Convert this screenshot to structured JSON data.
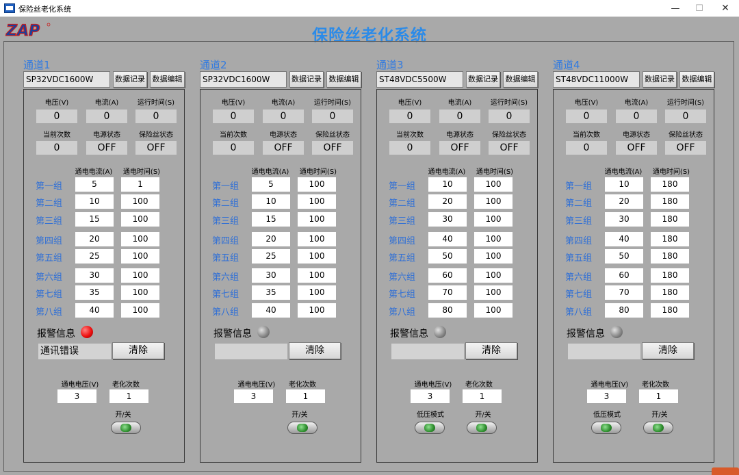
{
  "window": {
    "title": "保险丝老化系统",
    "minimize": "—",
    "maximize": "☐",
    "close": "✕"
  },
  "logo_text": "ZAP",
  "app_title": "保险丝老化系统",
  "labels": {
    "voltage": "电压(V)",
    "current": "电流(A)",
    "runtime": "运行时间(S)",
    "current_count": "当前次数",
    "power_state": "电源状态",
    "fuse_state": "保险丝状态",
    "col_current": "通电电流(A)",
    "col_time": "通电时间(S)",
    "alarm": "报警信息",
    "clear": "清除",
    "power_voltage": "通电电压(V)",
    "aging_count": "老化次数",
    "on_off": "开/关",
    "low_voltage_mode": "低压模式",
    "data_record": "数据记录",
    "data_edit": "数据编辑"
  },
  "groups": [
    "第一组",
    "第二组",
    "第三组",
    "第四组",
    "第五组",
    "第六组",
    "第七组",
    "第八组"
  ],
  "channels": [
    {
      "name": "通道1",
      "model": "SP32VDC1600W",
      "voltage": "0",
      "current": "0",
      "runtime": "0",
      "count": "0",
      "power_state": "OFF",
      "fuse_state": "OFF",
      "rows": [
        [
          "5",
          "1"
        ],
        [
          "10",
          "100"
        ],
        [
          "15",
          "100"
        ],
        [
          "20",
          "100"
        ],
        [
          "25",
          "100"
        ],
        [
          "30",
          "100"
        ],
        [
          "35",
          "100"
        ],
        [
          "40",
          "100"
        ]
      ],
      "alarm_text": "通讯错误",
      "alarm_active": true,
      "power_voltage": "3",
      "aging_count": "1",
      "has_low_voltage_mode": false
    },
    {
      "name": "通道2",
      "model": "SP32VDC1600W",
      "voltage": "0",
      "current": "0",
      "runtime": "0",
      "count": "0",
      "power_state": "OFF",
      "fuse_state": "OFF",
      "rows": [
        [
          "5",
          "100"
        ],
        [
          "10",
          "100"
        ],
        [
          "15",
          "100"
        ],
        [
          "20",
          "100"
        ],
        [
          "25",
          "100"
        ],
        [
          "30",
          "100"
        ],
        [
          "35",
          "100"
        ],
        [
          "40",
          "100"
        ]
      ],
      "alarm_text": "",
      "alarm_active": false,
      "power_voltage": "3",
      "aging_count": "1",
      "has_low_voltage_mode": false
    },
    {
      "name": "通道3",
      "model": "ST48VDC5500W",
      "voltage": "0",
      "current": "0",
      "runtime": "0",
      "count": "0",
      "power_state": "OFF",
      "fuse_state": "OFF",
      "rows": [
        [
          "10",
          "100"
        ],
        [
          "20",
          "100"
        ],
        [
          "30",
          "100"
        ],
        [
          "40",
          "100"
        ],
        [
          "50",
          "100"
        ],
        [
          "60",
          "100"
        ],
        [
          "70",
          "100"
        ],
        [
          "80",
          "100"
        ]
      ],
      "alarm_text": "",
      "alarm_active": false,
      "power_voltage": "3",
      "aging_count": "1",
      "has_low_voltage_mode": true
    },
    {
      "name": "通道4",
      "model": "ST48VDC11000W",
      "voltage": "0",
      "current": "0",
      "runtime": "0",
      "count": "0",
      "power_state": "OFF",
      "fuse_state": "OFF",
      "rows": [
        [
          "10",
          "180"
        ],
        [
          "20",
          "180"
        ],
        [
          "30",
          "180"
        ],
        [
          "40",
          "180"
        ],
        [
          "50",
          "180"
        ],
        [
          "60",
          "180"
        ],
        [
          "70",
          "180"
        ],
        [
          "80",
          "180"
        ]
      ],
      "alarm_text": "",
      "alarm_active": false,
      "power_voltage": "3",
      "aging_count": "1",
      "has_low_voltage_mode": true
    }
  ],
  "colors": {
    "background": "#a9a9a9",
    "title_blue": "#2c8be8",
    "group_blue": "#2f6fd6",
    "alarm_red": "#ee1010",
    "toggle_green": "#2f8f2f"
  }
}
